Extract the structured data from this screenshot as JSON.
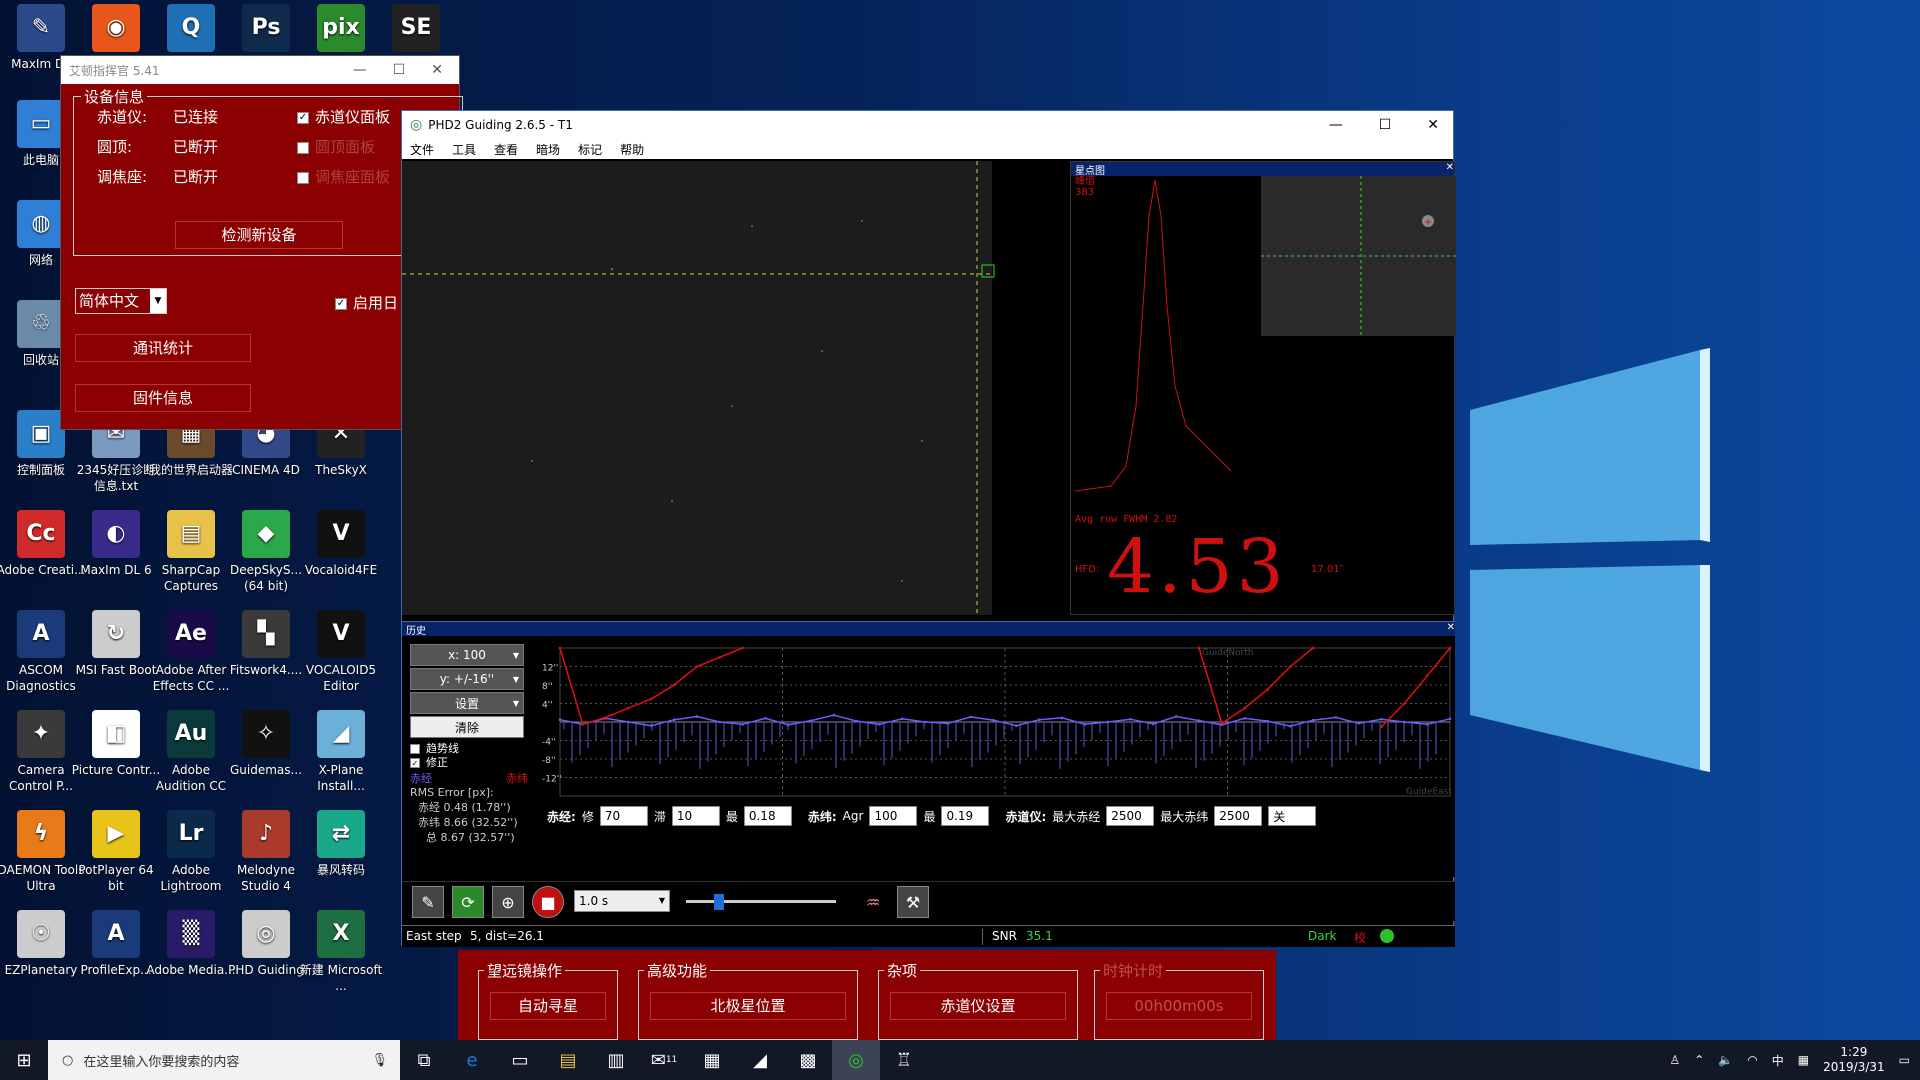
{
  "desktop": {
    "icons": [
      {
        "label": "MaxIm DL",
        "color": "#2a4a8a",
        "glyph": "✎"
      },
      {
        "label": "",
        "color": "#e8561a",
        "glyph": "◉"
      },
      {
        "label": "",
        "color": "#1f6fb5",
        "glyph": "Q"
      },
      {
        "label": "",
        "color": "#0f2a4a",
        "glyph": "Ps"
      },
      {
        "label": "",
        "color": "#2b8a2b",
        "glyph": "pix"
      },
      {
        "label": "",
        "color": "#222",
        "glyph": "SE"
      },
      {
        "label": "此电脑",
        "color": "#2f7fd6",
        "glyph": "▭"
      },
      {
        "label": "网络",
        "color": "#2f7fd6",
        "glyph": "◍"
      },
      {
        "label": "回收站",
        "color": "#6a8aa8",
        "glyph": "♲"
      },
      {
        "label": "控制面板",
        "color": "#2a7fc8",
        "glyph": "▣"
      },
      {
        "label": "2345好压诊断信息.txt",
        "color": "#7a9ac0",
        "glyph": "✉"
      },
      {
        "label": "我的世界启动器",
        "color": "#6a4a2a",
        "glyph": "▦"
      },
      {
        "label": "CINEMA 4D",
        "color": "#324a8a",
        "glyph": "◕"
      },
      {
        "label": "TheSkyX",
        "color": "#222",
        "glyph": "✕"
      },
      {
        "label": "Adobe Creati...",
        "color": "#d12a2a",
        "glyph": "Cc"
      },
      {
        "label": "MaxIm DL 6",
        "color": "#3a2a8a",
        "glyph": "◐"
      },
      {
        "label": "SharpCap Captures",
        "color": "#e8c14a",
        "glyph": "▤"
      },
      {
        "label": "DeepSkyS... (64 bit)",
        "color": "#2aa84a",
        "glyph": "◆"
      },
      {
        "label": "Vocaloid4FE",
        "color": "#111",
        "glyph": "V"
      },
      {
        "label": "ASCOM Diagnostics",
        "color": "#1a3a7a",
        "glyph": "A"
      },
      {
        "label": "MSI Fast Boot",
        "color": "#ccc",
        "glyph": "↻"
      },
      {
        "label": "Adobe After Effects CC ...",
        "color": "#1a0a4a",
        "glyph": "Ae"
      },
      {
        "label": "Fitswork4....",
        "color": "#3a3a3a",
        "glyph": "▚"
      },
      {
        "label": "VOCALOID5 Editor",
        "color": "#111",
        "glyph": "V"
      },
      {
        "label": "Camera Control P...",
        "color": "#3a3a3a",
        "glyph": "✦"
      },
      {
        "label": "Picture Contr...",
        "color": "#fff",
        "glyph": "◧"
      },
      {
        "label": "Adobe Audition CC",
        "color": "#0a3a3a",
        "glyph": "Au"
      },
      {
        "label": "Guidemas...",
        "color": "#111",
        "glyph": "✧"
      },
      {
        "label": "X-Plane Install...",
        "color": "#6ab0d8",
        "glyph": "◢"
      },
      {
        "label": "DAEMON Tools Ultra",
        "color": "#e87a1a",
        "glyph": "ϟ"
      },
      {
        "label": "PotPlayer 64 bit",
        "color": "#e8c41a",
        "glyph": "▶"
      },
      {
        "label": "Adobe Lightroom",
        "color": "#0a2a4a",
        "glyph": "Lr"
      },
      {
        "label": "Melodyne Studio 4",
        "color": "#aa3a2a",
        "glyph": "♪"
      },
      {
        "label": "暴风转码",
        "color": "#1aa88a",
        "glyph": "⇄"
      },
      {
        "label": "EZPlanetary",
        "color": "#ccc",
        "glyph": "☉"
      },
      {
        "label": "ProfileExp...",
        "color": "#1a3a7a",
        "glyph": "A"
      },
      {
        "label": "Adobe Media...",
        "color": "#2a1a6a",
        "glyph": "▒"
      },
      {
        "label": "PHD Guiding",
        "color": "#ccc",
        "glyph": "◎"
      },
      {
        "label": "新建 Microsoft ...",
        "color": "#1d6f42",
        "glyph": "X"
      }
    ]
  },
  "ascom": {
    "title": "艾顿指挥官 5.41",
    "group_title": "设备信息",
    "rows": [
      {
        "label": "赤道仪:",
        "value": "已连接",
        "check": "赤道仪面板",
        "checked": true
      },
      {
        "label": "圆顶:",
        "value": "已断开",
        "check": "圆顶面板",
        "checked": false
      },
      {
        "label": "调焦座:",
        "value": "已断开",
        "check": "调焦座面板",
        "checked": false
      }
    ],
    "detect_button": "检测新设备",
    "language": "简体中文",
    "enable_label": "启用日",
    "comm_button": "通讯统计",
    "firmware_button": "固件信息",
    "bottom": {
      "groups": [
        "望远镜操作",
        "高级功能",
        "杂项",
        "时钟计时"
      ],
      "buttons": [
        "自动寻星",
        "北极星位置",
        "赤道仪设置",
        "00h00m00s"
      ]
    }
  },
  "phd": {
    "title": "PHD2 Guiding 2.6.5 - T1",
    "menu": [
      "文件",
      "工具",
      "查看",
      "暗场",
      "标记",
      "帮助"
    ],
    "star_panel": {
      "title": "星点图",
      "peak_label": "峰值",
      "peak_value": "383",
      "fwhm_label": "Avg row FWHM  2.82",
      "hfd_label": "HFD:",
      "hfd_value": "4.53",
      "hfd_arcsec": "17.01″"
    },
    "history": {
      "title": "历史",
      "x_scale": "x: 100",
      "y_scale": "y: +/-16''",
      "settings": "设置",
      "clear": "清除",
      "trend": "趋势线",
      "correction": "修正",
      "ra_label": "赤经",
      "dec_label": "赤纬",
      "rms_title": "RMS Error [px]:",
      "rms_ra": "赤经 0.48 (1.78'')",
      "rms_dec": "赤纬 8.66 (32.52'')",
      "rms_total": "总 8.67 (32.57'')",
      "y_ticks": [
        "12''",
        "8''",
        "4''",
        "-4''",
        "-8''",
        "-12''"
      ],
      "guide_north": "GuideNorth",
      "guide_east": "GuideEast"
    },
    "controls": {
      "ra_title": "赤经:",
      "ra_agg_label": "修",
      "ra_agg": "70",
      "ra_hyst_label": "滞",
      "ra_hyst": "10",
      "ra_min_label": "最",
      "ra_min": "0.18",
      "dec_title": "赤纬:",
      "dec_agg_label": "Agr",
      "dec_agg": "100",
      "dec_min_label": "最",
      "dec_min": "0.19",
      "mount_title": "赤道仪:",
      "max_ra_label": "最大赤经",
      "max_ra": "2500",
      "max_dec_label": "最大赤纬",
      "max_dec": "2500",
      "dec_mode": "关"
    },
    "exposure": "1.0 s",
    "status": {
      "left": "East step",
      "step": "5, dist=26.1",
      "snr_label": "SNR",
      "snr_value": "35.1",
      "dark": "Dark",
      "cal": "校"
    }
  },
  "taskbar": {
    "search_placeholder": "在这里输入你要搜索的内容",
    "time": "1:29",
    "date": "2019/3/31",
    "ime": "中",
    "mail_badge": "11"
  },
  "chart_data": {
    "type": "line",
    "series": [
      {
        "name": "赤经",
        "color": "#6b5cff",
        "values": [
          0.5,
          -0.5,
          0.8,
          0,
          -0.8,
          0.5,
          1.2,
          0,
          -0.5,
          0.8,
          -0.6,
          0.3,
          1.5,
          0.2,
          -0.5,
          0.7,
          0,
          -0.3,
          1.1,
          0.4,
          -0.8,
          0.5,
          0.9,
          -0.5,
          0,
          0.6,
          -0.4,
          1.2,
          0.3,
          -0.6,
          0.8,
          0.2,
          -0.9,
          0.4,
          1.0,
          -0.3,
          0.6,
          0,
          -0.5,
          0.7
        ]
      },
      {
        "name": "赤纬",
        "color": "#e01010",
        "values": [
          16,
          -0.5,
          1,
          3,
          5,
          8,
          12,
          14,
          16,
          null,
          null,
          null,
          null,
          null,
          null,
          null,
          null,
          null,
          null,
          null,
          null,
          null,
          null,
          null,
          null,
          null,
          null,
          null,
          16,
          -0.3,
          3,
          7,
          12,
          16,
          null,
          null,
          -1,
          4,
          10,
          16
        ]
      }
    ],
    "ylim": [
      -16,
      16
    ]
  }
}
